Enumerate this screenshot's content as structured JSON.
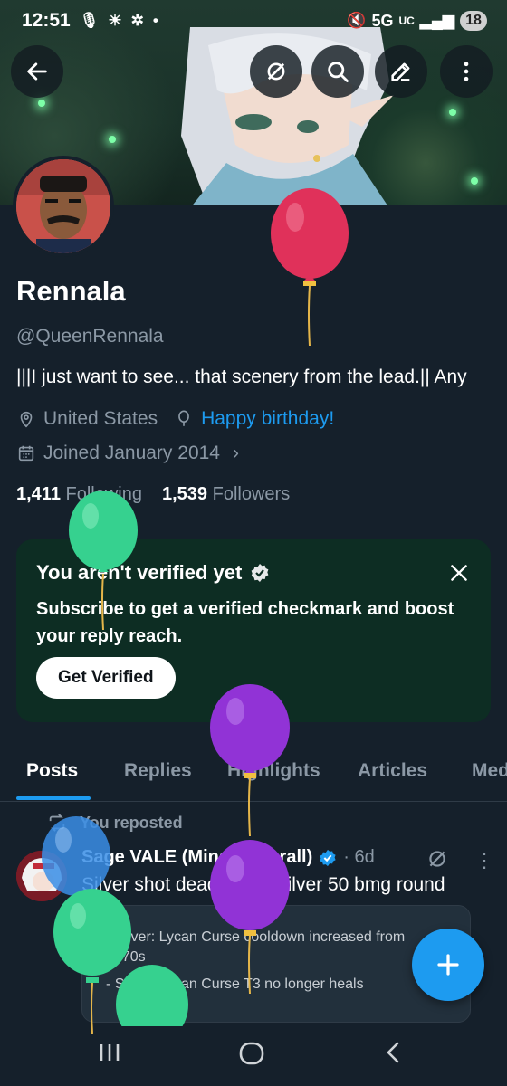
{
  "status_bar": {
    "time": "12:51",
    "network": "5G",
    "network_suffix": "UC",
    "battery": "18"
  },
  "header": {
    "back_icon": "arrow-left-icon",
    "grok_icon": "grok-icon",
    "search_icon": "search-icon",
    "edit_icon": "edit-pencil-icon",
    "more_icon": "more-vertical-icon"
  },
  "profile": {
    "name": "Rennala",
    "handle": "@QueenRennala",
    "bio": "|||I just want to see... that scenery from the lead.|| Any",
    "location": "United States",
    "birthday": "Happy birthday!",
    "joined": "Joined January 2014",
    "following_count": "1,411",
    "following_label": "Following",
    "followers_count": "1,539",
    "followers_label": "Followers"
  },
  "verify_card": {
    "title": "You aren't verified yet",
    "body": "Subscribe to get a verified checkmark and boost your reply reach.",
    "button": "Get Verified"
  },
  "tabs": [
    "Posts",
    "Replies",
    "Highlights",
    "Articles",
    "Med"
  ],
  "post": {
    "repost_label": "You reposted",
    "author": "Sage VALE (Mina Ha thrall)",
    "time": "· 6d",
    "text": "Silver shot dead with a silver 50 bmg round",
    "quote_lines": [
      "- Silver: Lycan Curse cooldown increased from",
      "to 70s",
      "- Silver: Lycan Curse T3 no longer heals"
    ]
  },
  "colors": {
    "background": "#15202b",
    "accent": "#1d9bf0",
    "muted": "#8b98a5",
    "card": "#0d2d23"
  }
}
